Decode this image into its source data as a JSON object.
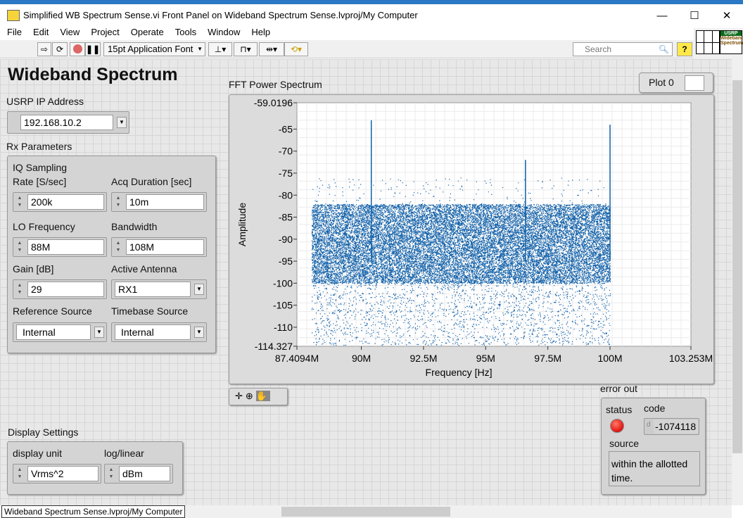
{
  "window": {
    "title": "Simplified WB Spectrum Sense.vi Front Panel on Wideband Spectrum Sense.lvproj/My Computer",
    "minimize": "—",
    "maximize": "☐",
    "close": "✕"
  },
  "menu": [
    "File",
    "Edit",
    "View",
    "Project",
    "Operate",
    "Tools",
    "Window",
    "Help"
  ],
  "toolbar": {
    "font": "15pt Application Font",
    "search_placeholder": "Search",
    "help": "?"
  },
  "connector_icon": {
    "line1": "USRP",
    "line2": "Wideband",
    "line3": "Spectrum"
  },
  "panel": {
    "title": "Wideband Spectrum",
    "usrp_ip_label": "USRP IP Address",
    "usrp_ip": "192.168.10.2",
    "rx_label": "Rx Parameters",
    "iq_label": "IQ Sampling",
    "rate_label": "Rate [S/sec]",
    "rate": "200k",
    "acq_label": "Acq Duration [sec]",
    "acq": "10m",
    "lo_label": "LO Frequency",
    "lo": "88M",
    "bw_label": "Bandwidth",
    "bw": "108M",
    "gain_label": "Gain [dB]",
    "gain": "29",
    "antenna_label": "Active Antenna",
    "antenna": "RX1",
    "ref_label": "Reference Source",
    "ref": "Internal",
    "timebase_label": "Timebase Source",
    "timebase": "Internal",
    "display_label": "Display Settings",
    "unit_label": "display unit",
    "unit": "Vrms^2",
    "loglin_label": "log/linear",
    "loglin": "dBm",
    "error_label": "error out",
    "status_label": "status",
    "code_label": "code",
    "code": "-1074118",
    "source_label": "source",
    "source_line1": "within the allotted",
    "source_line2": "time.",
    "status_color": "#e8201a"
  },
  "status_path": "Wideband Spectrum Sense.lvproj/My Computer",
  "chart_data": {
    "type": "scatter",
    "title": "FFT Power Spectrum",
    "legend": "Plot 0",
    "legend_placement": "top-right",
    "xlabel": "Frequency [Hz]",
    "ylabel": "Amplitude",
    "xlim": [
      87409400,
      103253000
    ],
    "ylim": [
      -114.327,
      -59.0196
    ],
    "xticks": [
      {
        "v": 87409400,
        "l": "87.4094M"
      },
      {
        "v": 90000000,
        "l": "90M"
      },
      {
        "v": 92500000,
        "l": "92.5M"
      },
      {
        "v": 95000000,
        "l": "95M"
      },
      {
        "v": 97500000,
        "l": "97.5M"
      },
      {
        "v": 100000000,
        "l": "100M"
      },
      {
        "v": 103253000,
        "l": "103.253M"
      }
    ],
    "yticks": [
      {
        "v": -59.0196,
        "l": "-59.0196"
      },
      {
        "v": -65,
        "l": "-65"
      },
      {
        "v": -70,
        "l": "-70"
      },
      {
        "v": -75,
        "l": "-75"
      },
      {
        "v": -80,
        "l": "-80"
      },
      {
        "v": -85,
        "l": "-85"
      },
      {
        "v": -90,
        "l": "-90"
      },
      {
        "v": -95,
        "l": "-95"
      },
      {
        "v": -100,
        "l": "-100"
      },
      {
        "v": -105,
        "l": "-105"
      },
      {
        "v": -110,
        "l": "-110"
      },
      {
        "v": -114.327,
        "l": "-114.327"
      }
    ],
    "grid": true,
    "color": "#0f5fa8",
    "noise_band": {
      "x_range": [
        88000000,
        100000000
      ],
      "dense_y_range": [
        -100,
        -82
      ],
      "sparse_y_range": [
        -114,
        -76
      ]
    },
    "peaks": [
      {
        "x": 90400000,
        "y": -63
      },
      {
        "x": 96600000,
        "y": -72
      },
      {
        "x": 100000000,
        "y": -64
      }
    ]
  }
}
